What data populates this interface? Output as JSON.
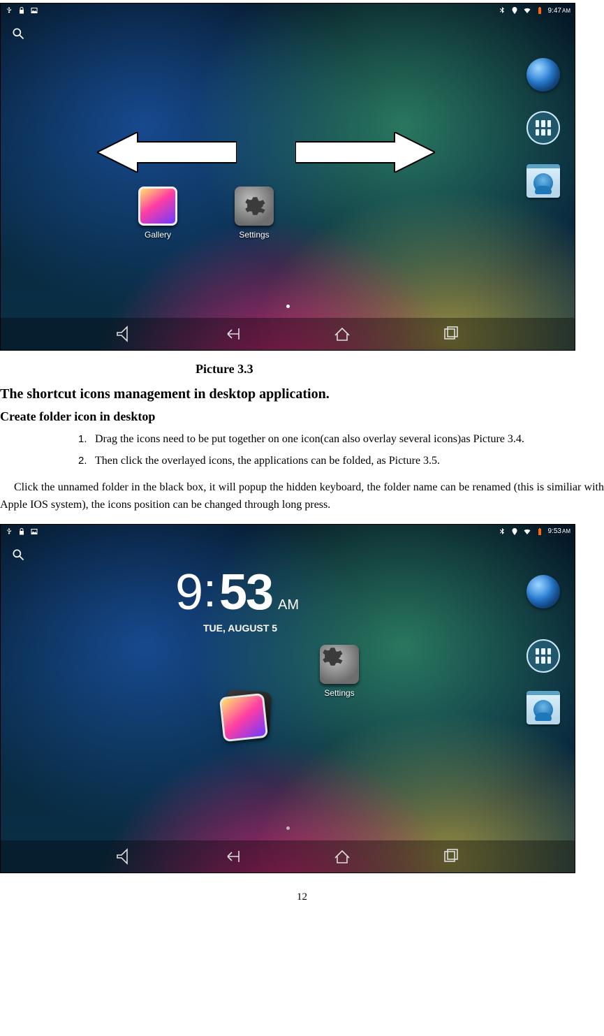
{
  "page_number": "12",
  "caption1": "Picture 3.3",
  "heading_main": "The shortcut icons management in desktop application.",
  "heading_sub": "Create folder icon in desktop",
  "list": [
    {
      "n": "1.",
      "t": "Drag the icons need to be put together on one icon(can also overlay several icons)as Picture 3.4."
    },
    {
      "n": "2.",
      "t": "Then click the overlayed icons, the applications can be folded, as Picture 3.5."
    }
  ],
  "para1": "Click the unnamed folder in the black box, it will popup the hidden keyboard, the folder name can be renamed (this is similiar with Apple IOS system), the icons position can be changed through long press.",
  "shot1": {
    "time": "9:47",
    "ampm": "AM",
    "apps": {
      "gallery": "Gallery",
      "settings": "Settings"
    }
  },
  "shot2": {
    "time": "9:53",
    "ampm": "AM",
    "clock_h": "9",
    "clock_m": "53",
    "clock_date": "TUE, AUGUST 5",
    "settings_label": "Settings"
  }
}
